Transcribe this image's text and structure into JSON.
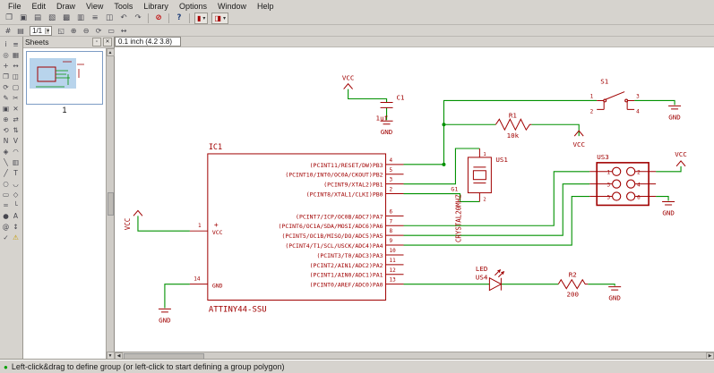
{
  "menubar": {
    "items": [
      {
        "name": "menu-file",
        "label": "File"
      },
      {
        "name": "menu-edit",
        "label": "Edit"
      },
      {
        "name": "menu-draw",
        "label": "Draw"
      },
      {
        "name": "menu-view",
        "label": "View"
      },
      {
        "name": "menu-tools",
        "label": "Tools"
      },
      {
        "name": "menu-library",
        "label": "Library"
      },
      {
        "name": "menu-options",
        "label": "Options"
      },
      {
        "name": "menu-window",
        "label": "Window"
      },
      {
        "name": "menu-help",
        "label": "Help"
      }
    ]
  },
  "toolbar_main": {
    "icons": [
      {
        "name": "open-folder-icon",
        "glyph": "❐"
      },
      {
        "name": "save-icon",
        "glyph": "▣"
      },
      {
        "name": "print-icon",
        "glyph": "▤"
      },
      {
        "name": "cam-processor-icon",
        "glyph": "▧"
      },
      {
        "name": "board-switch-icon",
        "glyph": "▩"
      },
      {
        "name": "library-icon",
        "glyph": "▥"
      },
      {
        "name": "options-icon",
        "glyph": "≡"
      },
      {
        "name": "window-icon",
        "glyph": "◫"
      },
      {
        "name": "undo-icon",
        "glyph": "↶"
      },
      {
        "name": "redo-icon",
        "glyph": "↷"
      }
    ],
    "stop_glyph": "⊘",
    "help_glyph": "?",
    "dropdown_a_glyph": "▮",
    "dropdown_b_glyph": "◨",
    "dropdown_arrow": "▾"
  },
  "toolbar_view": {
    "left_icons": [
      {
        "name": "grid-icon",
        "glyph": "#"
      },
      {
        "name": "layers-icon",
        "glyph": "▤"
      }
    ],
    "sheet_selector": "1/1",
    "zoom_icons": [
      {
        "name": "zoom-fit-icon",
        "glyph": "◱"
      },
      {
        "name": "zoom-in-icon",
        "glyph": "⊕"
      },
      {
        "name": "zoom-out-icon",
        "glyph": "⊖"
      },
      {
        "name": "redraw-icon",
        "glyph": "⟳"
      },
      {
        "name": "zoom-select-icon",
        "glyph": "▭"
      },
      {
        "name": "pan-icon",
        "glyph": "↔"
      }
    ]
  },
  "coordinate_bar": {
    "value": "0.1 inch (4.2 3.8)"
  },
  "sheets_panel": {
    "title": "Sheets",
    "sheet_label": "1"
  },
  "palette": {
    "tools": [
      {
        "name": "info-tool-icon",
        "glyph": "i"
      },
      {
        "name": "layer-settings-tool-icon",
        "glyph": "≡"
      },
      {
        "name": "show-tool-icon",
        "glyph": "◎"
      },
      {
        "name": "display-tool-icon",
        "glyph": "▦"
      },
      {
        "name": "mark-tool-icon",
        "glyph": "+"
      },
      {
        "name": "move-tool-icon",
        "glyph": "↔"
      },
      {
        "name": "copy-tool-icon",
        "glyph": "❐"
      },
      {
        "name": "mirror-tool-icon",
        "glyph": "◫"
      },
      {
        "name": "rotate-tool-icon",
        "glyph": "⟳"
      },
      {
        "name": "group-tool-icon",
        "glyph": "▢"
      },
      {
        "name": "change-tool-icon",
        "glyph": "✎"
      },
      {
        "name": "cut-tool-icon",
        "glyph": "✂"
      },
      {
        "name": "paste-tool-icon",
        "glyph": "▣"
      },
      {
        "name": "delete-tool-icon",
        "glyph": "✕"
      },
      {
        "name": "add-part-tool-icon",
        "glyph": "⊕"
      },
      {
        "name": "pinswap-tool-icon",
        "glyph": "⇄"
      },
      {
        "name": "replace-tool-icon",
        "glyph": "⟲"
      },
      {
        "name": "gateswap-tool-icon",
        "glyph": "⇅"
      },
      {
        "name": "name-tool-icon",
        "glyph": "N"
      },
      {
        "name": "value-tool-icon",
        "glyph": "V"
      },
      {
        "name": "smash-tool-icon",
        "glyph": "◈"
      },
      {
        "name": "miter-tool-icon",
        "glyph": "◠"
      },
      {
        "name": "split-tool-icon",
        "glyph": "╲"
      },
      {
        "name": "invoke-tool-icon",
        "glyph": "▥"
      },
      {
        "name": "wire-tool-icon",
        "glyph": "╱"
      },
      {
        "name": "text-tool-icon",
        "glyph": "T"
      },
      {
        "name": "circle-tool-icon",
        "glyph": "○"
      },
      {
        "name": "arc-tool-icon",
        "glyph": "◡"
      },
      {
        "name": "rect-tool-icon",
        "glyph": "▭"
      },
      {
        "name": "polygon-tool-icon",
        "glyph": "◇"
      },
      {
        "name": "bus-tool-icon",
        "glyph": "═"
      },
      {
        "name": "net-tool-icon",
        "glyph": "└"
      },
      {
        "name": "junction-tool-icon",
        "glyph": "●"
      },
      {
        "name": "label-tool-icon",
        "glyph": "A"
      },
      {
        "name": "attribute-tool-icon",
        "glyph": "@"
      },
      {
        "name": "dimension-tool-icon",
        "glyph": "↕"
      },
      {
        "name": "erc-tool-icon",
        "glyph": "✓"
      },
      {
        "name": "erc-errors-tool-icon",
        "glyph": "⚠"
      }
    ]
  },
  "statusbar": {
    "message": "Left-click&drag to define group (or left-click to start defining a group polygon)"
  },
  "icons": {
    "scroll_up": "▲",
    "scroll_down": "▼",
    "scroll_left": "◀",
    "scroll_right": "▶",
    "status_dot": "●",
    "dock": "▫",
    "close": "✕"
  },
  "schematic": {
    "colors": {
      "component": "#a00000",
      "net": "#009100"
    },
    "ic": {
      "ref": "IC1",
      "value": "ATTINY44-SSU",
      "plus": "+",
      "left_pins": [
        {
          "number": "1",
          "name": "VCC"
        },
        {
          "number": "14",
          "name": "GND"
        }
      ],
      "right_pins": [
        {
          "number": "4",
          "name": "(PCINT11/RESET/DW)PB3"
        },
        {
          "number": "5",
          "name": "(PCINT10/INT0/OC0A/CKOUT)PB2"
        },
        {
          "number": "3",
          "name": "(PCINT9/XTAL2)PB1"
        },
        {
          "number": "2",
          "name": "(PCINT8/XTAL1/CLKI)PB0"
        },
        {
          "number": "6",
          "name": "(PCINT7/ICP/OC0B/ADC7)PA7"
        },
        {
          "number": "7",
          "name": "(PCINT6/OC1A/SDA/MOSI/ADC6)PA6"
        },
        {
          "number": "8",
          "name": "(PCINT5/OC1B/MISO/DO/ADC5)PA5"
        },
        {
          "number": "9",
          "name": "(PCINT4/T1/SCL/USCK/ADC4)PA4"
        },
        {
          "number": "10",
          "name": "(PCINT3/T0/ADC3)PA3"
        },
        {
          "number": "11",
          "name": "(PCINT2/AIN1/ADC2)PA2"
        },
        {
          "number": "12",
          "name": "(PCINT1/AIN0/ADC1)PA1"
        },
        {
          "number": "13",
          "name": "(PCINT0/AREF/ADC0)PA0"
        }
      ]
    },
    "c1": {
      "ref": "C1",
      "value": "1uf"
    },
    "r1": {
      "ref": "R1",
      "value": "10k"
    },
    "r2": {
      "ref": "R2",
      "value": "200"
    },
    "s1": {
      "ref": "S1",
      "pin1": "1",
      "pin2": "2",
      "pin3": "3",
      "pin4": "4"
    },
    "us1": {
      "ref": "US1",
      "value": "CRYSTAL20MHZ",
      "gate": "G1",
      "pin_top": "1",
      "pin_bottom": "2"
    },
    "us3": {
      "ref": "US3",
      "pins": [
        "1",
        "2",
        "3",
        "4",
        "5",
        "6"
      ]
    },
    "us4": {
      "ref": "US4",
      "value": "LED"
    },
    "labels": {
      "vcc": "VCC",
      "gnd": "GND"
    }
  }
}
